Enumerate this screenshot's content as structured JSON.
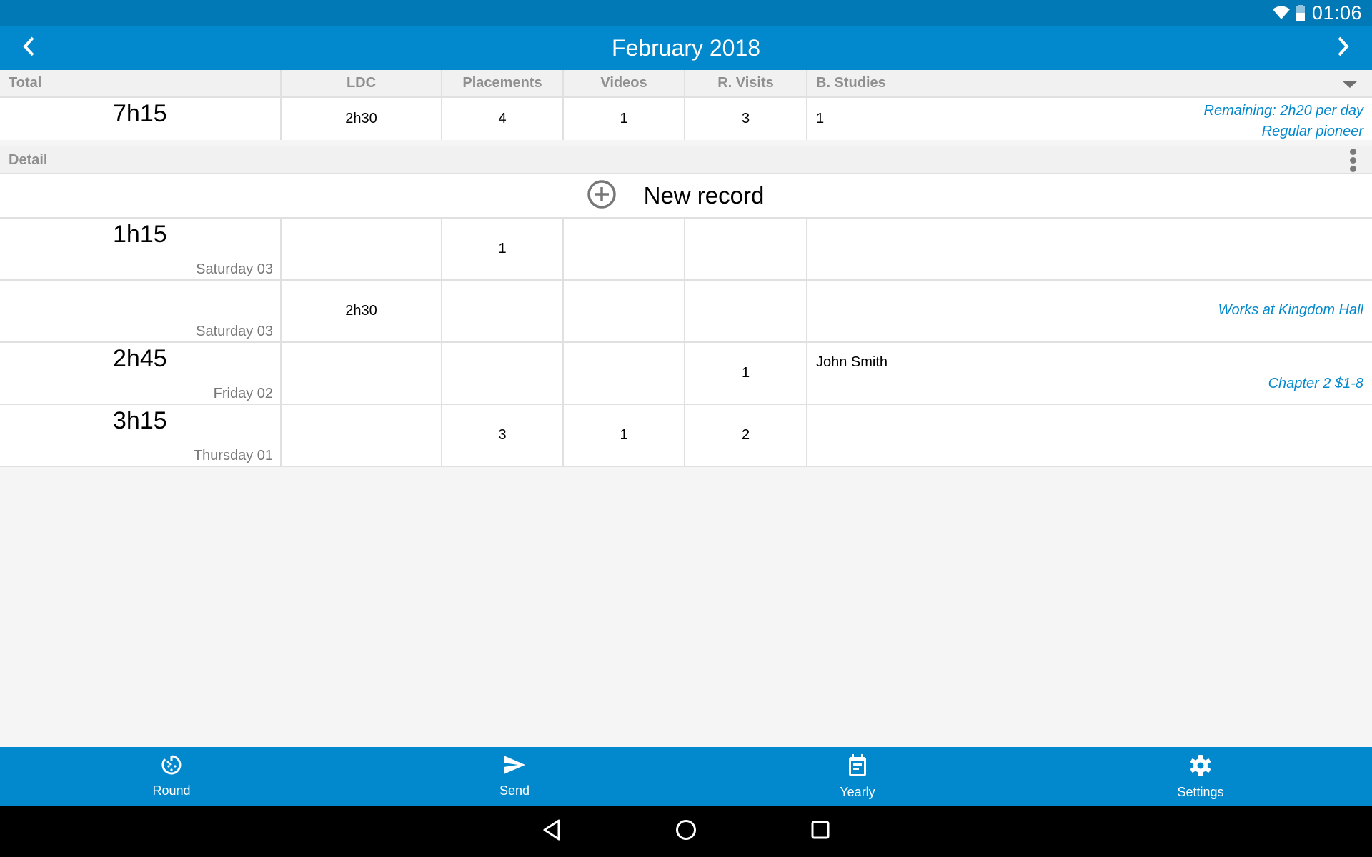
{
  "status_bar": {
    "time": "01:06",
    "icons": [
      "wifi-icon",
      "battery-icon"
    ]
  },
  "app_bar": {
    "title": "February 2018",
    "prev_icon": "chevron-left-icon",
    "next_icon": "chevron-right-icon"
  },
  "columns": [
    "Total",
    "LDC",
    "Placements",
    "Videos",
    "R. Visits",
    "B. Studies"
  ],
  "totals": {
    "total": "7h15",
    "ldc": "2h30",
    "placements": "4",
    "videos": "1",
    "return_visits": "3",
    "bible_studies": "1",
    "remaining": "Remaining: 2h20 per day",
    "pioneer_type": "Regular pioneer"
  },
  "detail": {
    "label": "Detail",
    "new_record_label": "New record",
    "rows": [
      {
        "hours": "1h15",
        "date": "Saturday 03",
        "ldc": "",
        "placements": "1",
        "videos": "",
        "return_visits": "",
        "study_name": "",
        "note": ""
      },
      {
        "hours": "",
        "date": "Saturday 03",
        "ldc": "2h30",
        "placements": "",
        "videos": "",
        "return_visits": "",
        "study_name": "",
        "note": "Works at Kingdom Hall"
      },
      {
        "hours": "2h45",
        "date": "Friday 02",
        "ldc": "",
        "placements": "",
        "videos": "",
        "return_visits": "1",
        "study_name": "John Smith",
        "note": "Chapter 2 $1-8"
      },
      {
        "hours": "3h15",
        "date": "Thursday 01",
        "ldc": "",
        "placements": "3",
        "videos": "1",
        "return_visits": "2",
        "study_name": "",
        "note": ""
      }
    ]
  },
  "bottom_nav": [
    {
      "label": "Round",
      "icon": "timer-icon"
    },
    {
      "label": "Send",
      "icon": "send-icon"
    },
    {
      "label": "Yearly",
      "icon": "calendar-icon"
    },
    {
      "label": "Settings",
      "icon": "gear-icon"
    }
  ],
  "colors": {
    "primary": "#0288cc",
    "primary_dark": "#0079b6",
    "accent_text": "#0288cc",
    "header_bg": "#f1f1f1",
    "header_text": "#8f8f8f"
  }
}
